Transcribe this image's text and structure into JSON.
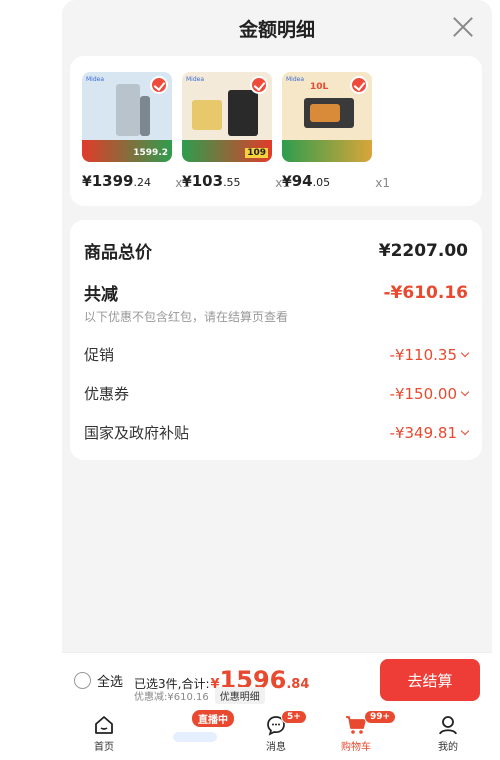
{
  "sheet": {
    "title": "金额明细"
  },
  "products": [
    {
      "price_int": "1399",
      "price_dec": ".24",
      "qty": "x1",
      "brand": "Midea",
      "tag": "1599.2"
    },
    {
      "price_int": "103",
      "price_dec": ".55",
      "qty": "x1",
      "brand": "Midea",
      "tag": "109"
    },
    {
      "price_int": "94",
      "price_dec": ".05",
      "qty": "x1",
      "brand": "Midea",
      "tag": "10L"
    }
  ],
  "currency": "¥",
  "summary": {
    "total_label": "商品总价",
    "total_value": "¥2207.00",
    "reduce_label": "共减",
    "reduce_value": "-¥610.16",
    "note": "以下优惠不包含红包，请在结算页查看",
    "items": [
      {
        "label": "促销",
        "value": "-¥110.35"
      },
      {
        "label": "优惠券",
        "value": "-¥150.00"
      },
      {
        "label": "国家及政府补贴",
        "value": "-¥349.81"
      }
    ]
  },
  "bottom_bar": {
    "select_all": "全选",
    "selected_text": "已选3件,合计:",
    "currency": "¥",
    "total_int": "1596",
    "total_dec": ".84",
    "discount_text": "优惠减:¥610.16",
    "detail_pill": "优惠明细",
    "checkout": "去结算"
  },
  "nav": {
    "home": "首页",
    "live_badge": "直播中",
    "messages": "消息",
    "messages_badge": "5+",
    "cart": "购物车",
    "cart_badge": "99+",
    "mine": "我的"
  },
  "colors": {
    "accent": "#e8492f",
    "checkout": "#ee3d37",
    "background": "#f4f4f4"
  },
  "icons": [
    "close-icon",
    "check-icon",
    "chevron-down-icon",
    "home-icon",
    "message-icon",
    "cart-icon",
    "user-icon"
  ]
}
